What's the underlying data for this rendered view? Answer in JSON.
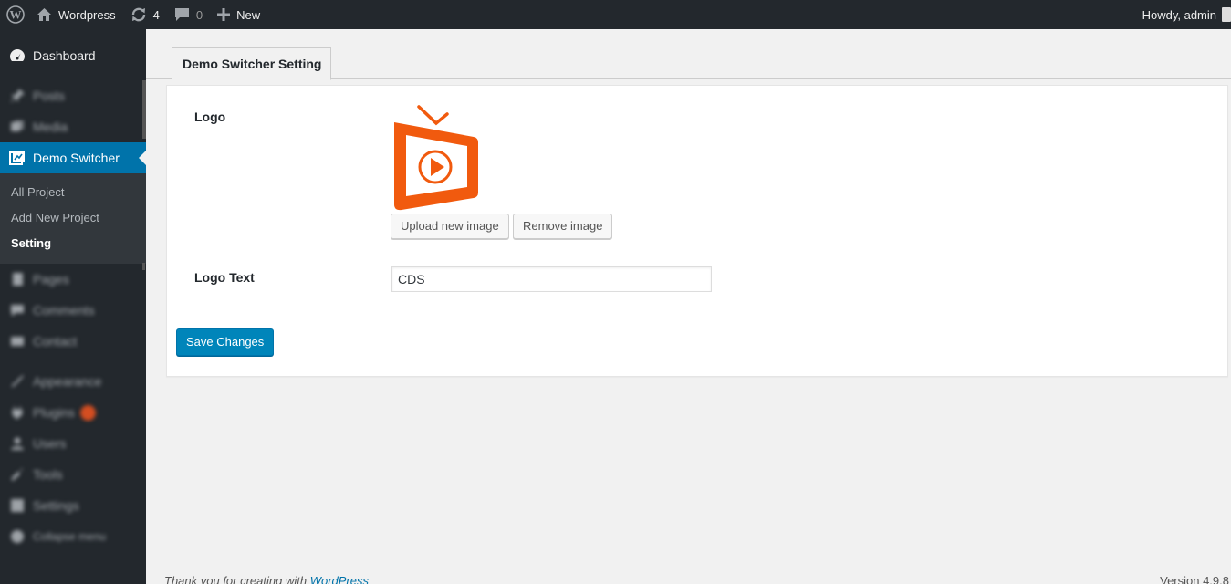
{
  "admin_bar": {
    "site_name": "Wordpress",
    "updates_count": "4",
    "comments_count": "0",
    "new_label": "New",
    "greeting": "Howdy, admin"
  },
  "sidebar": {
    "items": [
      {
        "label": "Dashboard",
        "icon": "dashboard-icon"
      },
      {
        "label": "Posts",
        "icon": "pin-icon"
      },
      {
        "label": "Media",
        "icon": "media-icon"
      },
      {
        "label": "Demo Switcher",
        "icon": "demo-switcher-icon"
      },
      {
        "label": "Pages",
        "icon": "page-icon"
      },
      {
        "label": "Comments",
        "icon": "comment-icon"
      },
      {
        "label": "Contact",
        "icon": "mail-icon"
      },
      {
        "label": "Appearance",
        "icon": "brush-icon"
      },
      {
        "label": "Plugins",
        "icon": "plugin-icon"
      },
      {
        "label": "Users",
        "icon": "user-icon"
      },
      {
        "label": "Tools",
        "icon": "wrench-icon"
      },
      {
        "label": "Settings",
        "icon": "settings-icon"
      },
      {
        "label": "Collapse menu",
        "icon": "collapse-icon"
      }
    ],
    "submenu": [
      "All Project",
      "Add New Project",
      "Setting"
    ]
  },
  "main": {
    "tab_label": "Demo Switcher Setting",
    "logo_label": "Logo",
    "upload_button": "Upload new image",
    "remove_button": "Remove image",
    "logo_text_label": "Logo Text",
    "logo_text_value": "CDS",
    "save_button": "Save Changes"
  },
  "footer": {
    "thanks_prefix": "Thank you for creating with ",
    "thanks_link": "WordPress",
    "version": "Version 4.9.8"
  },
  "colors": {
    "admin_bar": "#23282d",
    "accent": "#0073aa",
    "primary_button": "#0085ba",
    "logo_orange": "#f15a0e"
  }
}
